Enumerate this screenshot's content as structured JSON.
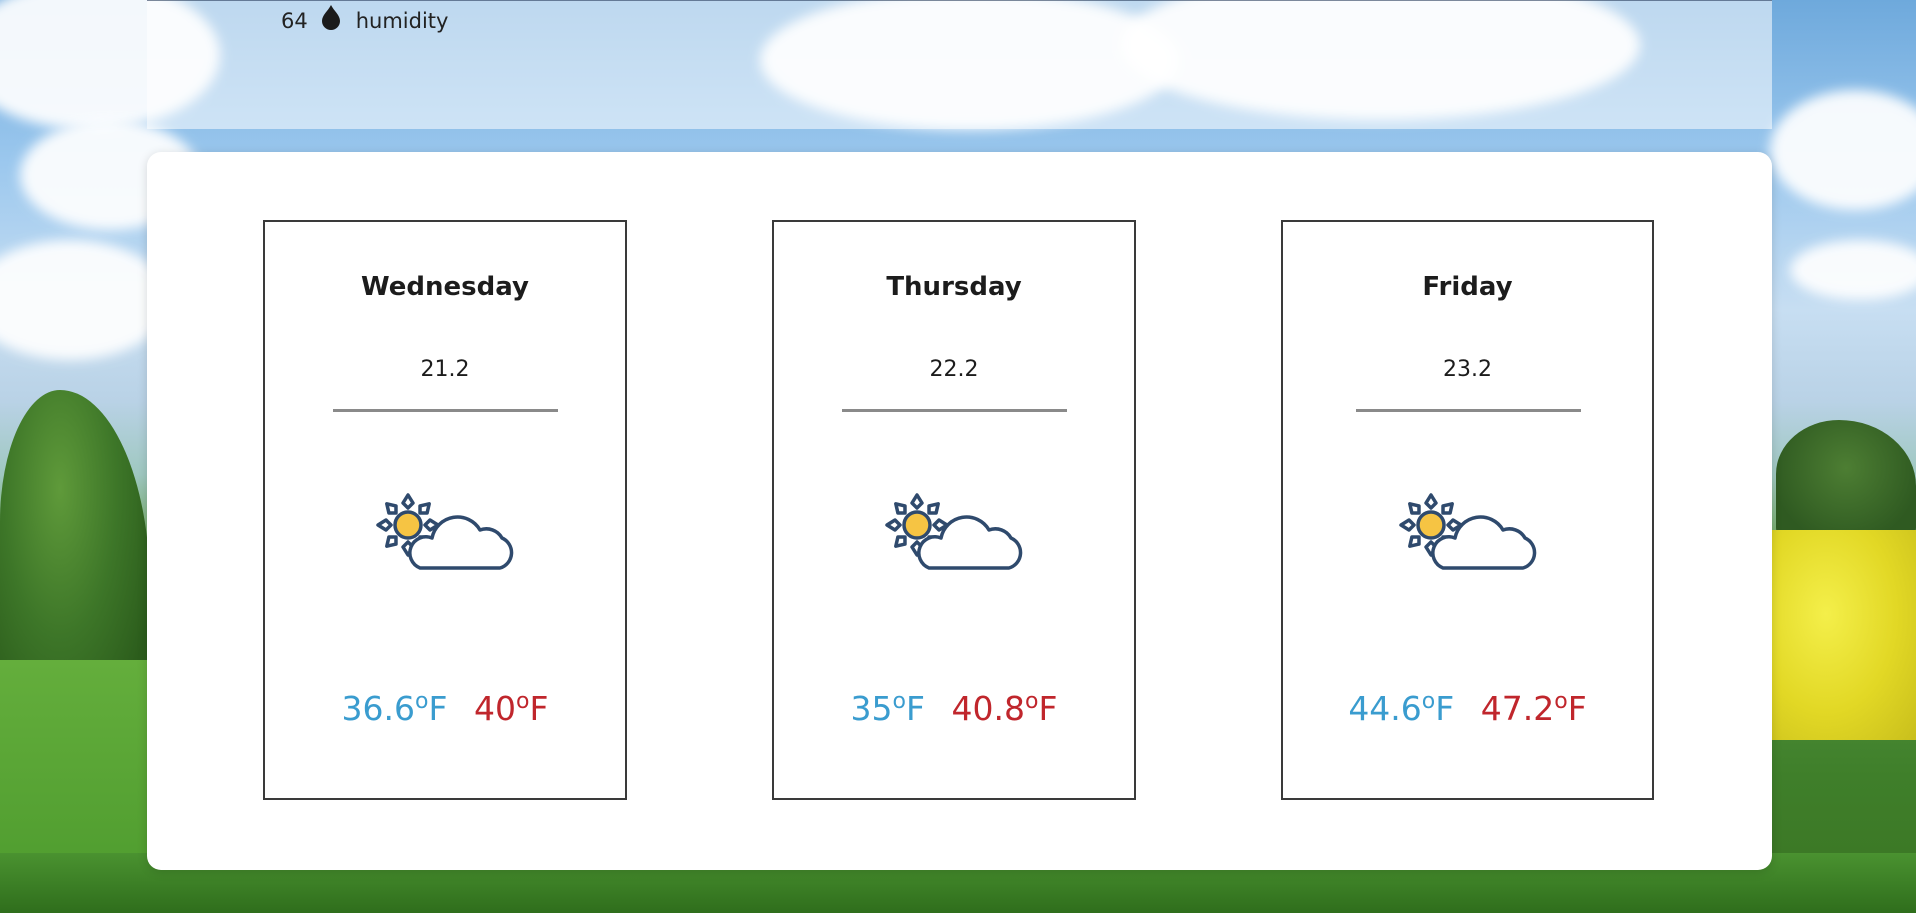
{
  "colors": {
    "low_temp": "#3a9ccf",
    "high_temp": "#c0262c",
    "icon_outline": "#2f4a6d",
    "sun_fill": "#f6c443"
  },
  "humidity": {
    "value": "64",
    "label": "humidity",
    "icon": "droplet-icon"
  },
  "forecast": [
    {
      "day": "Wednesday",
      "value": "21.2",
      "icon": "partly-cloudy-icon",
      "low": "36.6",
      "high": "40",
      "low_unit": "F",
      "high_unit": "F",
      "deg_symbol": "o"
    },
    {
      "day": "Thursday",
      "value": "22.2",
      "icon": "partly-cloudy-icon",
      "low": "35",
      "high": "40.8",
      "low_unit": "F",
      "high_unit": "F",
      "deg_symbol": "o"
    },
    {
      "day": "Friday",
      "value": "23.2",
      "icon": "partly-cloudy-icon",
      "low": "44.6",
      "high": "47.2",
      "low_unit": "F",
      "high_unit": "F",
      "deg_symbol": "o"
    }
  ]
}
